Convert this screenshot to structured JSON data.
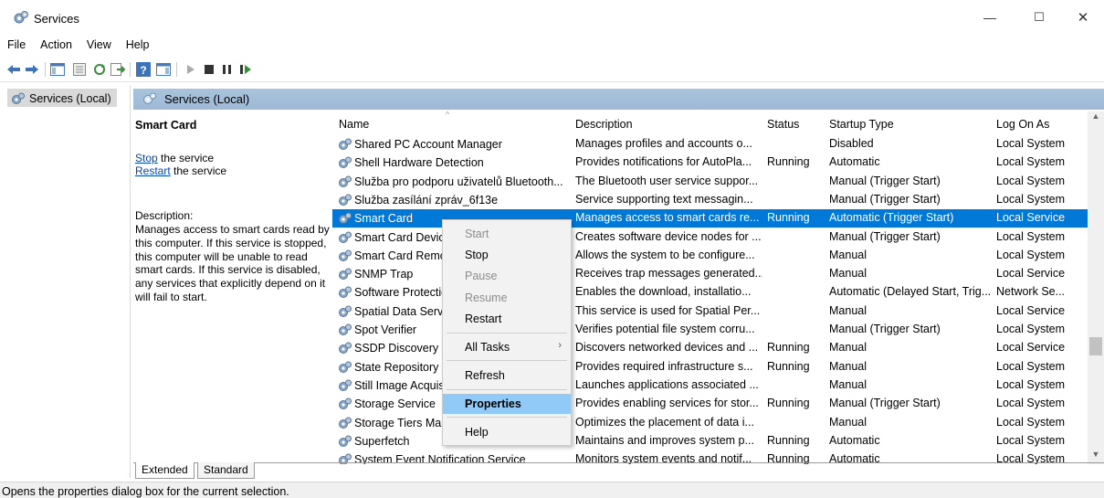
{
  "window": {
    "title": "Services",
    "controls": [
      "—",
      "☐",
      "✕"
    ]
  },
  "menu": [
    "File",
    "Action",
    "View",
    "Help"
  ],
  "tree": {
    "item": "Services (Local)"
  },
  "header": {
    "label": "Services (Local)"
  },
  "detail": {
    "title": "Smart Card",
    "stop_link": "Stop",
    "stop_suffix": " the service",
    "restart_link": "Restart",
    "restart_suffix": " the service",
    "desc_heading": "Description:",
    "desc_text": "Manages access to smart cards read by this computer. If this service is stopped, this computer will be unable to read smart cards. If this service is disabled, any services that explicitly depend on it will fail to start."
  },
  "columns": {
    "name": "Name",
    "description": "Description",
    "status": "Status",
    "startup": "Startup Type",
    "logon": "Log On As"
  },
  "rows": [
    [
      "Shared PC Account Manager",
      "Manages profiles and accounts o...",
      "",
      "Disabled",
      "Local System"
    ],
    [
      "Shell Hardware Detection",
      "Provides notifications for AutoPla...",
      "Running",
      "Automatic",
      "Local System"
    ],
    [
      "Služba pro podporu uživatelů Bluetooth...",
      "The Bluetooth user service suppor...",
      "",
      "Manual (Trigger Start)",
      "Local System"
    ],
    [
      "Služba zasílání zpráv_6f13e",
      "Service supporting text messagin...",
      "",
      "Manual (Trigger Start)",
      "Local System"
    ],
    [
      "Smart Card",
      "Manages access to smart cards re...",
      "Running",
      "Automatic (Trigger Start)",
      "Local Service"
    ],
    [
      "Smart Card Device Enumeration Service",
      "Creates software device nodes for ...",
      "",
      "Manual (Trigger Start)",
      "Local System"
    ],
    [
      "Smart Card Removal Policy",
      "Allows the system to be configure...",
      "",
      "Manual",
      "Local System"
    ],
    [
      "SNMP Trap",
      "Receives trap messages generated...",
      "",
      "Manual",
      "Local Service"
    ],
    [
      "Software Protection",
      "Enables the download, installatio...",
      "",
      "Automatic (Delayed Start, Trig...",
      "Network Se..."
    ],
    [
      "Spatial Data Service",
      "This service is used for Spatial Per...",
      "",
      "Manual",
      "Local Service"
    ],
    [
      "Spot Verifier",
      "Verifies potential file system corru...",
      "",
      "Manual (Trigger Start)",
      "Local System"
    ],
    [
      "SSDP Discovery",
      "Discovers networked devices and ...",
      "Running",
      "Manual",
      "Local Service"
    ],
    [
      "State Repository Service",
      "Provides required infrastructure s...",
      "Running",
      "Manual",
      "Local System"
    ],
    [
      "Still Image Acquisition Events",
      "Launches applications associated ...",
      "",
      "Manual",
      "Local System"
    ],
    [
      "Storage Service",
      "Provides enabling services for stor...",
      "Running",
      "Manual (Trigger Start)",
      "Local System"
    ],
    [
      "Storage Tiers Management",
      "Optimizes the placement of data i...",
      "",
      "Manual",
      "Local System"
    ],
    [
      "Superfetch",
      "Maintains and improves system p...",
      "Running",
      "Automatic",
      "Local System"
    ],
    [
      "System Event Notification Service",
      "Monitors system events and notif...",
      "Running",
      "Automatic",
      "Local System"
    ]
  ],
  "selected_row": 4,
  "context_menu": {
    "start": "Start",
    "stop": "Stop",
    "pause": "Pause",
    "resume": "Resume",
    "restart": "Restart",
    "all_tasks": "All Tasks",
    "all_tasks_arrow": "›",
    "refresh": "Refresh",
    "properties": "Properties",
    "help": "Help"
  },
  "tabs": [
    "Extended",
    "Standard"
  ],
  "statusbar": "Opens the properties dialog box for the current selection.",
  "colors": {
    "selection": "#0078d7",
    "menu_highlight": "#91c9f7",
    "header_band": "#a9c3dc",
    "link": "#0645ad"
  },
  "icons": {
    "app": "services-gear-icon",
    "row": "service-gear-icon"
  }
}
